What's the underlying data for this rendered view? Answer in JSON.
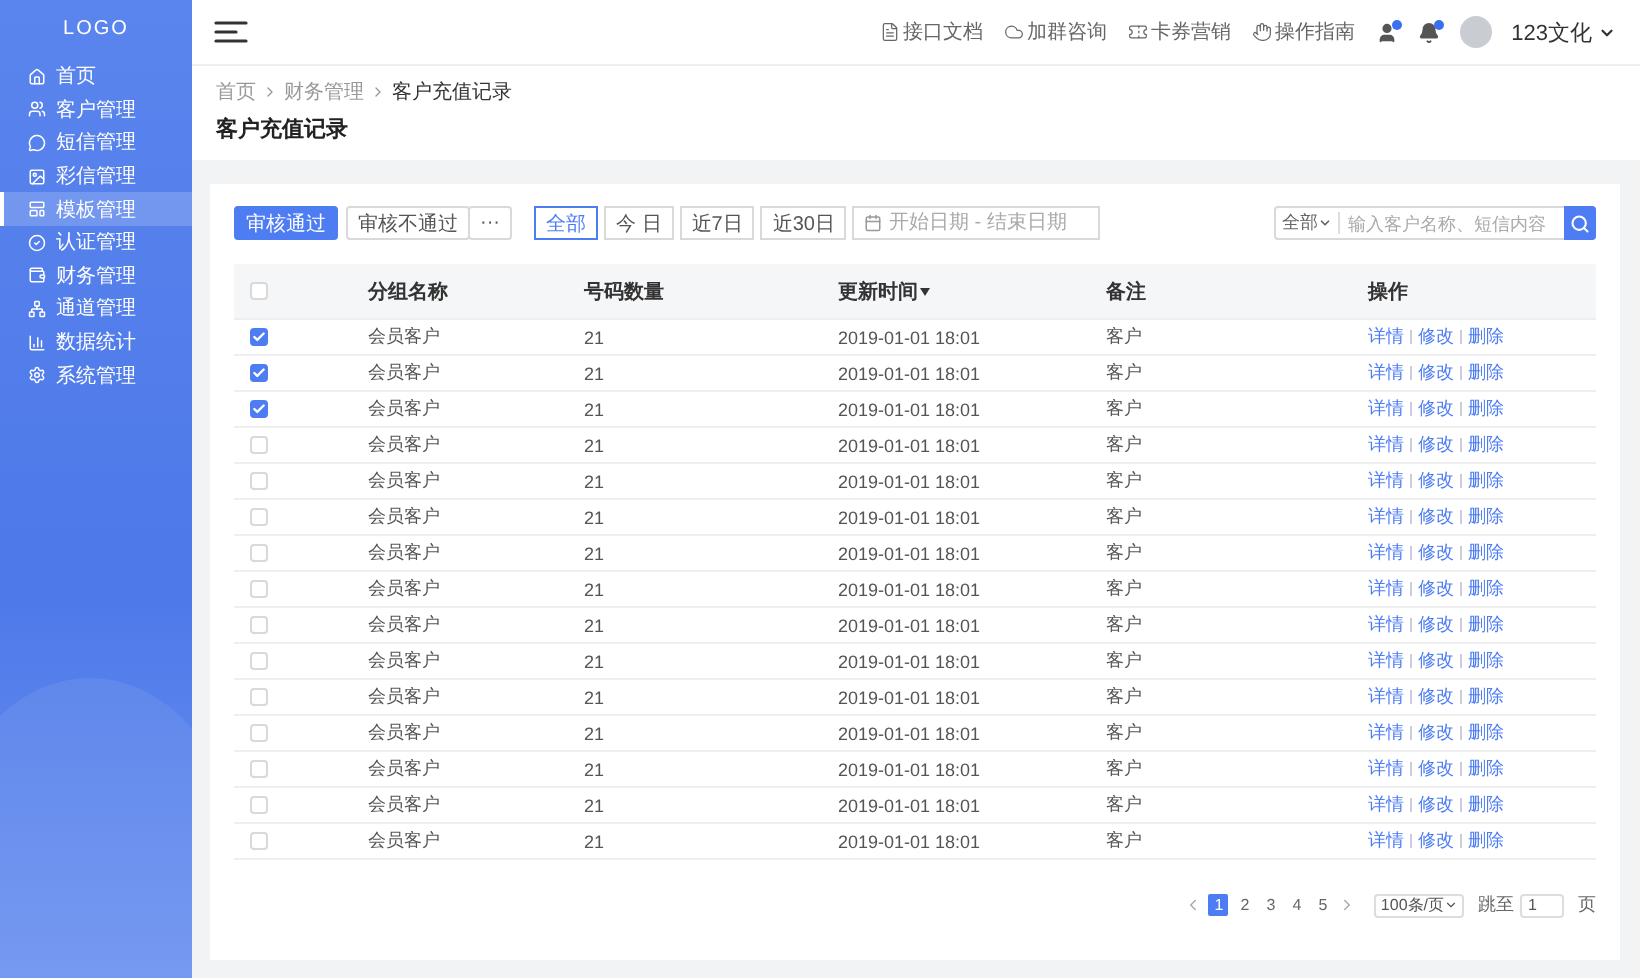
{
  "sidebar": {
    "logo": "LOGO",
    "items": [
      {
        "label": "首页",
        "selected": false
      },
      {
        "label": "客户管理",
        "selected": false
      },
      {
        "label": "短信管理",
        "selected": false
      },
      {
        "label": "彩信管理",
        "selected": false
      },
      {
        "label": "模板管理",
        "selected": true
      },
      {
        "label": "认证管理",
        "selected": false
      },
      {
        "label": "财务管理",
        "selected": false
      },
      {
        "label": "通道管理",
        "selected": false
      },
      {
        "label": "数据统计",
        "selected": false
      },
      {
        "label": "系统管理",
        "selected": false
      }
    ]
  },
  "header": {
    "links": [
      {
        "label": "接口文档"
      },
      {
        "label": "加群咨询"
      },
      {
        "label": "卡券营销"
      },
      {
        "label": "操作指南"
      }
    ],
    "icon_buttons": [
      {
        "badge": true
      },
      {
        "badge": true
      }
    ],
    "user": {
      "name": "123文化"
    }
  },
  "breadcrumb": [
    "首页",
    "财务管理",
    "客户充值记录"
  ],
  "page_title": "客户充值记录",
  "toolbar": {
    "actions": [
      {
        "label": "审核通过",
        "kind": "primary"
      },
      {
        "label": "审核不通过",
        "kind": "default"
      },
      {
        "label": "···",
        "kind": "more"
      }
    ],
    "ranges": [
      {
        "label": "全部",
        "selected": true
      },
      {
        "label": "今 日",
        "selected": false
      },
      {
        "label": "近7日",
        "selected": false
      },
      {
        "label": "近30日",
        "selected": false
      }
    ],
    "date_range": {
      "placeholder": "开始日期 - 结束日期"
    },
    "search": {
      "scope": "全部",
      "placeholder": "输入客户名称、短信内容"
    }
  },
  "table": {
    "all_checked": false,
    "columns": [
      {
        "label": "分组名称",
        "sorted": false
      },
      {
        "label": "号码数量",
        "sorted": false
      },
      {
        "label": "更新时间",
        "sorted": true
      },
      {
        "label": "备注",
        "sorted": false
      },
      {
        "label": "操作",
        "sorted": false
      }
    ],
    "rows": [
      {
        "checked": true,
        "group": "会员客户",
        "count": "21",
        "time": "2019-01-01 18:01",
        "note": "客户",
        "actions": [
          "详情",
          "修改",
          "删除"
        ]
      },
      {
        "checked": true,
        "group": "会员客户",
        "count": "21",
        "time": "2019-01-01 18:01",
        "note": "客户",
        "actions": [
          "详情",
          "修改",
          "删除"
        ]
      },
      {
        "checked": true,
        "group": "会员客户",
        "count": "21",
        "time": "2019-01-01 18:01",
        "note": "客户",
        "actions": [
          "详情",
          "修改",
          "删除"
        ]
      },
      {
        "checked": false,
        "group": "会员客户",
        "count": "21",
        "time": "2019-01-01 18:01",
        "note": "客户",
        "actions": [
          "详情",
          "修改",
          "删除"
        ]
      },
      {
        "checked": false,
        "group": "会员客户",
        "count": "21",
        "time": "2019-01-01 18:01",
        "note": "客户",
        "actions": [
          "详情",
          "修改",
          "删除"
        ]
      },
      {
        "checked": false,
        "group": "会员客户",
        "count": "21",
        "time": "2019-01-01 18:01",
        "note": "客户",
        "actions": [
          "详情",
          "修改",
          "删除"
        ]
      },
      {
        "checked": false,
        "group": "会员客户",
        "count": "21",
        "time": "2019-01-01 18:01",
        "note": "客户",
        "actions": [
          "详情",
          "修改",
          "删除"
        ]
      },
      {
        "checked": false,
        "group": "会员客户",
        "count": "21",
        "time": "2019-01-01 18:01",
        "note": "客户",
        "actions": [
          "详情",
          "修改",
          "删除"
        ]
      },
      {
        "checked": false,
        "group": "会员客户",
        "count": "21",
        "time": "2019-01-01 18:01",
        "note": "客户",
        "actions": [
          "详情",
          "修改",
          "删除"
        ]
      },
      {
        "checked": false,
        "group": "会员客户",
        "count": "21",
        "time": "2019-01-01 18:01",
        "note": "客户",
        "actions": [
          "详情",
          "修改",
          "删除"
        ]
      },
      {
        "checked": false,
        "group": "会员客户",
        "count": "21",
        "time": "2019-01-01 18:01",
        "note": "客户",
        "actions": [
          "详情",
          "修改",
          "删除"
        ]
      },
      {
        "checked": false,
        "group": "会员客户",
        "count": "21",
        "time": "2019-01-01 18:01",
        "note": "客户",
        "actions": [
          "详情",
          "修改",
          "删除"
        ]
      },
      {
        "checked": false,
        "group": "会员客户",
        "count": "21",
        "time": "2019-01-01 18:01",
        "note": "客户",
        "actions": [
          "详情",
          "修改",
          "删除"
        ]
      },
      {
        "checked": false,
        "group": "会员客户",
        "count": "21",
        "time": "2019-01-01 18:01",
        "note": "客户",
        "actions": [
          "详情",
          "修改",
          "删除"
        ]
      },
      {
        "checked": false,
        "group": "会员客户",
        "count": "21",
        "time": "2019-01-01 18:01",
        "note": "客户",
        "actions": [
          "详情",
          "修改",
          "删除"
        ]
      }
    ]
  },
  "pagination": {
    "pages": [
      {
        "label": "1",
        "selected": true
      },
      {
        "label": "2",
        "selected": false
      },
      {
        "label": "3",
        "selected": false
      },
      {
        "label": "4",
        "selected": false
      },
      {
        "label": "5",
        "selected": false
      }
    ],
    "page_size": "100条/页",
    "jump_label": "跳至",
    "jump_value": "1",
    "page_unit": "页"
  }
}
